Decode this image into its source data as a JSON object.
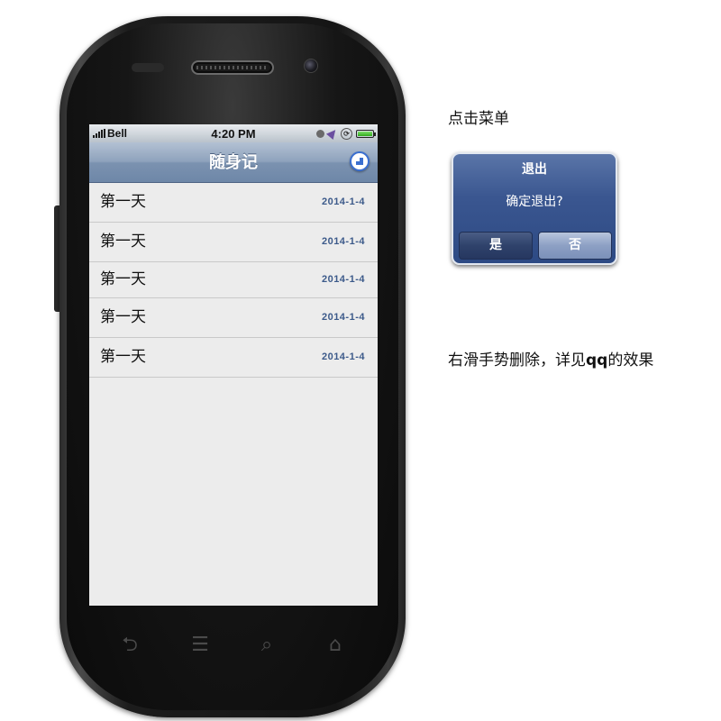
{
  "status_bar": {
    "carrier": "Bell",
    "time": "4:20 PM"
  },
  "nav_bar": {
    "title": "随身记"
  },
  "notes": [
    {
      "title": "第一天",
      "date": "2014-1-4"
    },
    {
      "title": "第一天",
      "date": "2014-1-4"
    },
    {
      "title": "第一天",
      "date": "2014-1-4"
    },
    {
      "title": "第一天",
      "date": "2014-1-4"
    },
    {
      "title": "第一天",
      "date": "2014-1-4"
    }
  ],
  "annotations": {
    "menu_note": "点击菜单",
    "swipe_note_prefix": "右滑手势删除，详见",
    "swipe_note_bold": "qq",
    "swipe_note_suffix": "的效果"
  },
  "dialog": {
    "title": "退出",
    "message": "确定退出?",
    "yes_label": "是",
    "no_label": "否"
  },
  "icons": {
    "add": "plus-circle-icon",
    "signal": "signal-bars-icon",
    "battery": "battery-icon",
    "location": "location-arrow-icon",
    "orientation_lock": "orientation-lock-icon",
    "back": "back-icon",
    "menu": "menu-icon",
    "search": "search-icon",
    "home": "home-icon"
  },
  "colors": {
    "nav_bar": "#7b92b0",
    "date_text": "#3c5a8a",
    "dialog_bg": "#3a5690",
    "add_button": "#3a6fd0"
  }
}
